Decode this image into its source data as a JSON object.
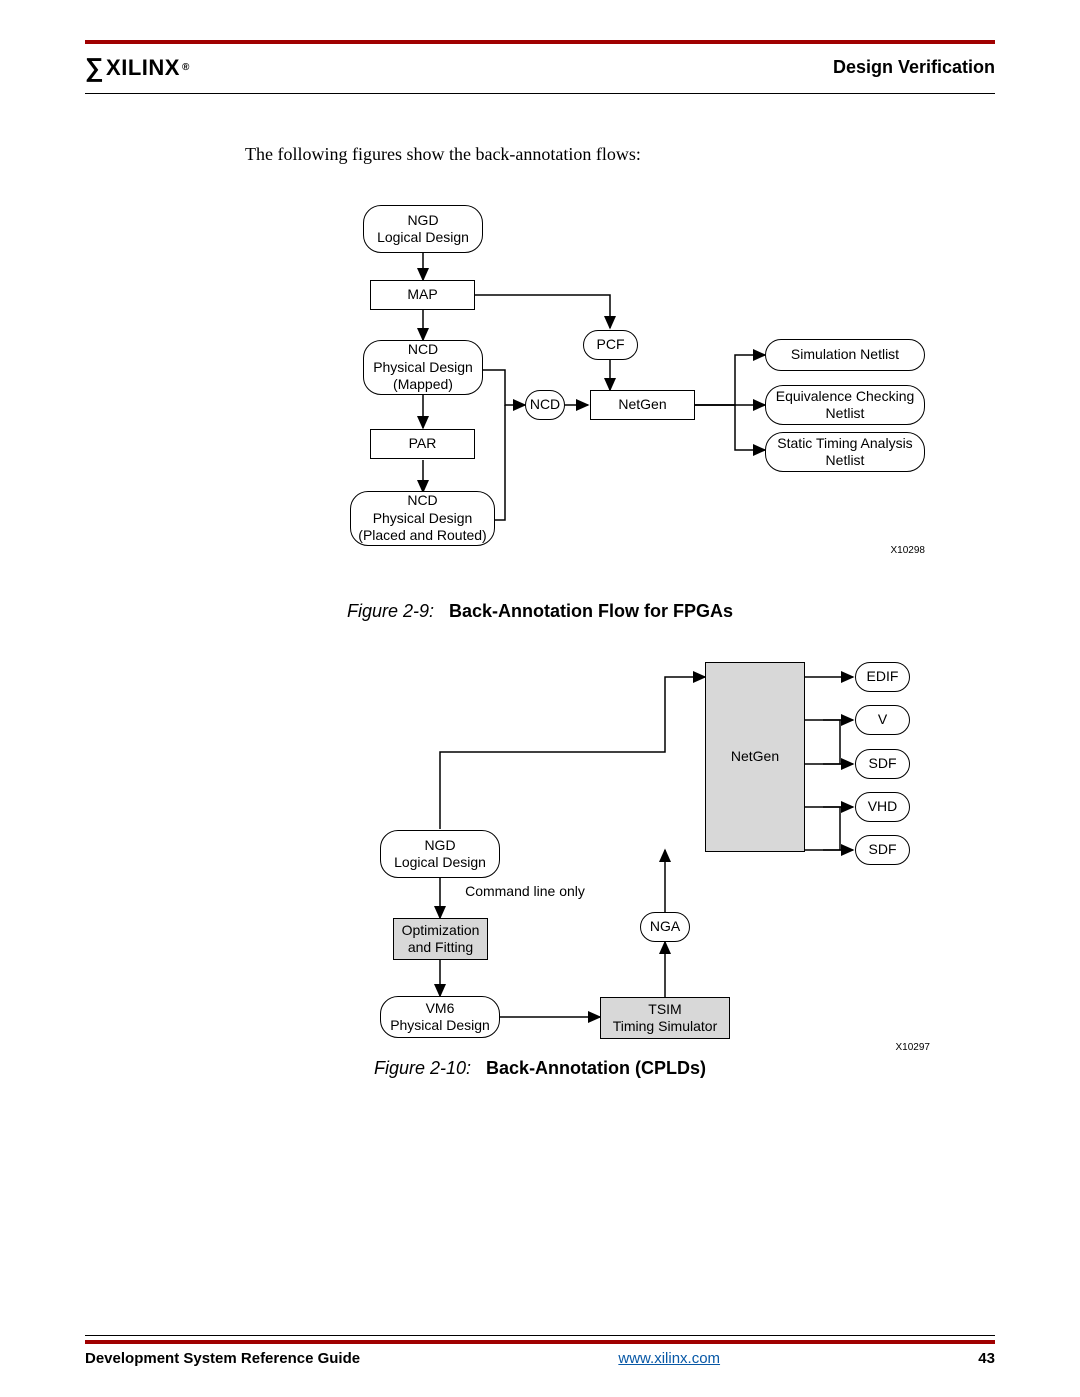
{
  "header": {
    "logo_text": "XILINX",
    "section": "Design Verification"
  },
  "intro": "The following figures show the back-annotation flows:",
  "fig1": {
    "ngd_l1": "NGD",
    "ngd_l2": "Logical Design",
    "map": "MAP",
    "ncd1_l1": "NCD",
    "ncd1_l2": "Physical Design",
    "ncd1_l3": "(Mapped)",
    "par": "PAR",
    "ncd2_l1": "NCD",
    "ncd2_l2": "Physical Design",
    "ncd2_l3": "(Placed and Routed)",
    "pcf": "PCF",
    "ncd_small": "NCD",
    "netgen": "NetGen",
    "out1": "Simulation Netlist",
    "out2_l1": "Equivalence Checking",
    "out2_l2": "Netlist",
    "out3_l1": "Static Timing Analysis",
    "out3_l2": "Netlist",
    "id": "X10298",
    "caption_label": "Figure 2-9:",
    "caption_text": "Back-Annotation Flow for FPGAs"
  },
  "fig2": {
    "ngd_l1": "NGD",
    "ngd_l2": "Logical Design",
    "cmd": "Command line only",
    "opt_l1": "Optimization",
    "opt_l2": "and Fitting",
    "vm6_l1": "VM6",
    "vm6_l2": "Physical Design",
    "netgen": "NetGen",
    "nga": "NGA",
    "tsim_l1": "TSIM",
    "tsim_l2": "Timing Simulator",
    "edif": "EDIF",
    "v": "V",
    "sdf1": "SDF",
    "vhd": "VHD",
    "sdf2": "SDF",
    "id": "X10297",
    "caption_label": "Figure 2-10:",
    "caption_text": "Back-Annotation (CPLDs)"
  },
  "footer": {
    "left": "Development System Reference Guide",
    "center": "www.xilinx.com",
    "right": "43"
  }
}
